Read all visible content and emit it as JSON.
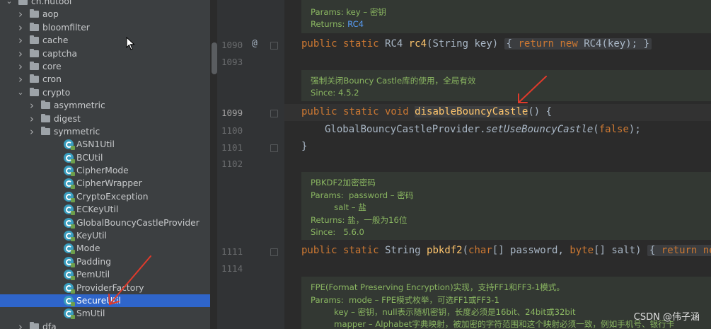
{
  "tree": {
    "rows": [
      {
        "label": "cn.hutool",
        "indent": 0,
        "arrow": "open",
        "icon": "folder"
      },
      {
        "label": "aop",
        "indent": 1,
        "arrow": "closed",
        "icon": "folder"
      },
      {
        "label": "bloomfilter",
        "indent": 1,
        "arrow": "closed",
        "icon": "folder"
      },
      {
        "label": "cache",
        "indent": 1,
        "arrow": "closed",
        "icon": "folder"
      },
      {
        "label": "captcha",
        "indent": 1,
        "arrow": "closed",
        "icon": "folder"
      },
      {
        "label": "core",
        "indent": 1,
        "arrow": "closed",
        "icon": "folder"
      },
      {
        "label": "cron",
        "indent": 1,
        "arrow": "closed",
        "icon": "folder"
      },
      {
        "label": "crypto",
        "indent": 1,
        "arrow": "open",
        "icon": "folder"
      },
      {
        "label": "asymmetric",
        "indent": 2,
        "arrow": "closed",
        "icon": "folder"
      },
      {
        "label": "digest",
        "indent": 2,
        "arrow": "closed",
        "icon": "folder"
      },
      {
        "label": "symmetric",
        "indent": 2,
        "arrow": "closed",
        "icon": "folder"
      },
      {
        "label": "ASN1Util",
        "indent": 2,
        "arrow": "none",
        "icon": "class"
      },
      {
        "label": "BCUtil",
        "indent": 2,
        "arrow": "none",
        "icon": "class"
      },
      {
        "label": "CipherMode",
        "indent": 2,
        "arrow": "none",
        "icon": "class"
      },
      {
        "label": "CipherWrapper",
        "indent": 2,
        "arrow": "none",
        "icon": "class"
      },
      {
        "label": "CryptoException",
        "indent": 2,
        "arrow": "none",
        "icon": "class"
      },
      {
        "label": "ECKeyUtil",
        "indent": 2,
        "arrow": "none",
        "icon": "class"
      },
      {
        "label": "GlobalBouncyCastleProvider",
        "indent": 2,
        "arrow": "none",
        "icon": "class"
      },
      {
        "label": "KeyUtil",
        "indent": 2,
        "arrow": "none",
        "icon": "class"
      },
      {
        "label": "Mode",
        "indent": 2,
        "arrow": "none",
        "icon": "class"
      },
      {
        "label": "Padding",
        "indent": 2,
        "arrow": "none",
        "icon": "class"
      },
      {
        "label": "PemUtil",
        "indent": 2,
        "arrow": "none",
        "icon": "class"
      },
      {
        "label": "ProviderFactory",
        "indent": 2,
        "arrow": "none",
        "icon": "class"
      },
      {
        "label": "SecureUtil",
        "indent": 2,
        "arrow": "none",
        "icon": "class",
        "selected": true
      },
      {
        "label": "SmUtil",
        "indent": 2,
        "arrow": "none",
        "icon": "class"
      },
      {
        "label": "dfa",
        "indent": 1,
        "arrow": "closed",
        "icon": "folder"
      }
    ]
  },
  "editor": {
    "doc1": {
      "params_label": "Params:",
      "params_text": "key – 密钥",
      "returns_label": "Returns:",
      "returns_link": "RC4"
    },
    "line1090": {
      "num": "1090",
      "code_pre": "public static RC4 ",
      "code_fn": "rc4",
      "code_args": "(String key) ",
      "fold_text": "{ return new RC4(key); }"
    },
    "line1093": {
      "num": "1093"
    },
    "doc2": {
      "desc": "强制关闭Bouncy Castle库的使用，全局有效",
      "since": "Since: 4.5.2"
    },
    "line1099": {
      "num": "1099",
      "code_pre": "public static void ",
      "code_fn": "disableBouncyCastle",
      "code_post": "() {"
    },
    "line1100": {
      "num": "1100",
      "code_obj": "GlobalBouncyCastleProvider.",
      "code_call": "setUseBouncyCastle",
      "code_open": "(",
      "code_false": "false",
      "code_close": ");"
    },
    "line1101": {
      "num": "1101",
      "code": "}"
    },
    "line1102": {
      "num": "1102"
    },
    "doc3": {
      "desc": "PBKDF2加密密码",
      "params1": "Params:  password – 密码",
      "params2": "         salt – 盐",
      "returns": "Returns: 盐，一般为16位",
      "since": "Since:   5.6.0"
    },
    "line1111": {
      "num": "1111",
      "code_pre": "public static String ",
      "code_fn": "pbkdf2",
      "code_args": "(char[] password, byte[] salt) ",
      "fold_text": "{ return ne"
    },
    "line1114": {
      "num": "1114"
    },
    "doc4": {
      "desc": "FPE(Format Preserving Encryption)实现，支持FF1和FF3-1模式。",
      "p1": "Params:  mode – FPE模式枚举，可选FF1或FF3-1",
      "p2": "         key – 密钥，null表示随机密钥，长度必须是16bit、24bit或32bit",
      "p3": "         mapper – Alphabet字典映射，被加密的字符范围和这个映射必须一致，例如手机号、银行卡"
    }
  },
  "watermark": "CSDN @伟子涵",
  "annotations": {
    "arrow_color": "#e03a2b"
  }
}
